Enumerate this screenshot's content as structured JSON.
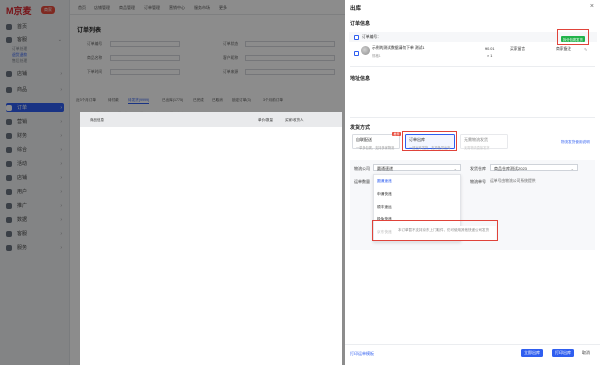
{
  "app": {
    "logo": "M京麦",
    "badge": "商家"
  },
  "sidebar": {
    "items": [
      {
        "label": "首页"
      },
      {
        "label": "客服"
      },
      {
        "label": "店铺"
      },
      {
        "label": "商品"
      },
      {
        "label": "订单"
      },
      {
        "label": "营销"
      },
      {
        "label": "财务"
      },
      {
        "label": "综合"
      },
      {
        "label": "活动"
      },
      {
        "label": "店铺"
      },
      {
        "label": "用户"
      },
      {
        "label": "推广"
      },
      {
        "label": "数据"
      },
      {
        "label": "客服"
      },
      {
        "label": "服务"
      }
    ],
    "subs": [
      "订单处理",
      "退货退款",
      "售后处理"
    ]
  },
  "topnav": {
    "items": [
      "首页",
      "店铺管理",
      "商品管理",
      "订单管理",
      "营销中心",
      "服务市场",
      "更多"
    ]
  },
  "page": {
    "title": "订单列表",
    "filters": [
      "订单编号",
      "订单状态",
      "商品名称",
      "商品编码",
      "客户昵称",
      "下单时间",
      "订单来源"
    ],
    "tabs": [
      "近3个月订单",
      "待付款",
      "待发货(9999)",
      "已出库(1775)",
      "已完成",
      "已取消",
      "锁定订单(3)",
      "3个月前订单"
    ],
    "actions": [
      "批量出库",
      "批量打印",
      "批量导入出库",
      "批量备注"
    ],
    "cols": [
      "商品信息",
      "单价/数量",
      "买家/收货人"
    ]
  },
  "drawer": {
    "title": "出库",
    "close": "×",
    "order_section": "订单信息",
    "order_no_label": "订单编号：",
    "split_button": "拆分包裹发货",
    "product_name": "示例的测试数据请勿下单 测试1",
    "product_sub": "规格1",
    "price": "¥0.01",
    "qty": "× 1",
    "status": "买家留言",
    "remark": "商家备注",
    "address_section": "地址信息",
    "ship_section": "发货方式",
    "ship_methods": [
      {
        "title": "自联配送",
        "sub": "一单多包裹，支持多家物流",
        "badge": "推荐"
      },
      {
        "title": "订单出库",
        "sub": "一键出库发货，支持批量出库"
      },
      {
        "title": "无需物流发货",
        "sub": "无需物流直接发货"
      }
    ],
    "ship_help": "物流发货使用说明",
    "carrier_label": "物流公司",
    "carrier_value": "圆通速递",
    "waybill_label": "运单数量",
    "dd_options": [
      "圆通速递",
      "申通快递",
      "顺丰速运",
      "极兔快递"
    ],
    "dd_disabled": "京东快递",
    "dd_notice": "本订单暂不支持京东上门取件，仍可使用其他快递公司发货",
    "wh_label": "发货仓库",
    "wh_value": "商品仓库测试2023",
    "track_label": "物流单号",
    "track_value": "运单号由物流公司系统提供",
    "footer_link": "打印运单模板",
    "btn_confirm": "立即出库",
    "btn_print": "打印出库",
    "btn_cancel": "取消"
  }
}
